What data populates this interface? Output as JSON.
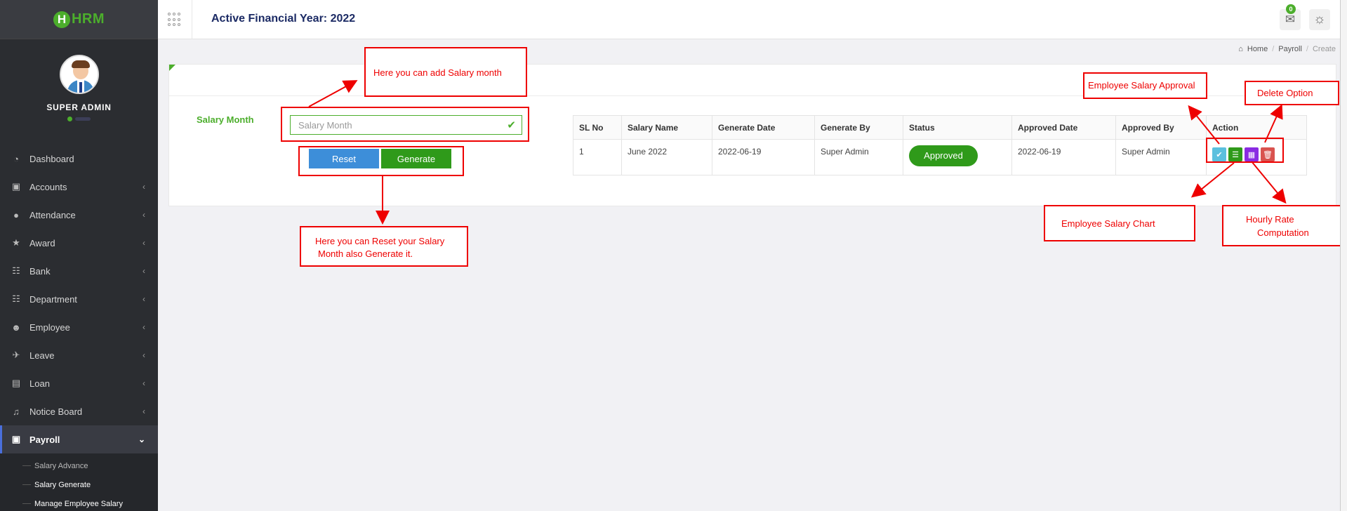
{
  "app": {
    "logo_text": "HRM",
    "logo_letter": "H"
  },
  "profile": {
    "name": "SUPER ADMIN"
  },
  "sidebar": {
    "items": [
      {
        "label": "Dashboard",
        "icon": "dashboard-icon"
      },
      {
        "label": "Accounts",
        "icon": "accounts-icon"
      },
      {
        "label": "Attendance",
        "icon": "attendance-icon"
      },
      {
        "label": "Award",
        "icon": "trophy-icon"
      },
      {
        "label": "Bank",
        "icon": "bank-icon"
      },
      {
        "label": "Department",
        "icon": "department-icon"
      },
      {
        "label": "Employee",
        "icon": "employee-icon"
      },
      {
        "label": "Leave",
        "icon": "plane-icon"
      },
      {
        "label": "Loan",
        "icon": "money-icon"
      },
      {
        "label": "Notice Board",
        "icon": "bell-icon"
      },
      {
        "label": "Payroll",
        "icon": "card-icon"
      }
    ],
    "submenu": [
      {
        "label": "Salary Advance"
      },
      {
        "label": "Salary Generate"
      },
      {
        "label": "Manage Employee Salary"
      }
    ]
  },
  "header": {
    "title": "Active Financial Year: 2022",
    "mail_count": "0"
  },
  "breadcrumb": {
    "home": "Home",
    "section": "Payroll",
    "current": "Create"
  },
  "form": {
    "label": "Salary Month",
    "placeholder": "Salary Month",
    "reset_label": "Reset",
    "generate_label": "Generate"
  },
  "table": {
    "headers": [
      "SL No",
      "Salary Name",
      "Generate Date",
      "Generate By",
      "Status",
      "Approved Date",
      "Approved By",
      "Action"
    ],
    "rows": [
      {
        "sl": "1",
        "name": "June 2022",
        "generate_date": "2022-06-19",
        "generate_by": "Super Admin",
        "status": "Approved",
        "approved_date": "2022-06-19",
        "approved_by": "Super Admin"
      }
    ]
  },
  "annotations": {
    "add_month": "Here you can add Salary month",
    "reset_generate_line1": "Here you can Reset your Salary",
    "reset_generate_line2": "Month also Generate it.",
    "approval": "Employee Salary Approval",
    "delete": "Delete Option",
    "chart": "Employee Salary Chart",
    "hourly_line1": "Hourly Rate",
    "hourly_line2": "Computation"
  },
  "colors": {
    "brand_green": "#4cae2c",
    "sidebar_bg": "#2b2d31",
    "annotation_red": "#e00000",
    "reset_blue": "#3d8ed9"
  }
}
